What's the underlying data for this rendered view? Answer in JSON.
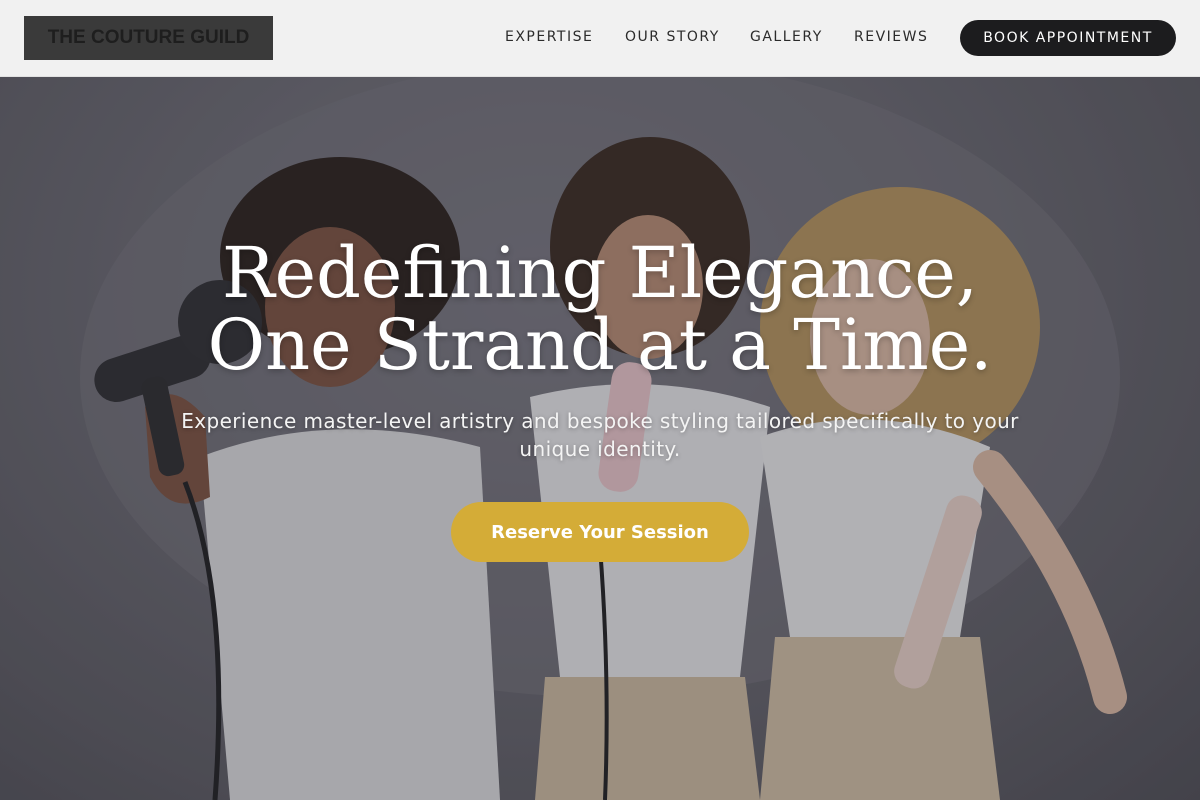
{
  "brand": {
    "name": "THE COUTURE GUILD"
  },
  "nav": {
    "items": [
      {
        "label": "EXPERTISE"
      },
      {
        "label": "OUR STORY"
      },
      {
        "label": "GALLERY"
      },
      {
        "label": "REVIEWS"
      }
    ],
    "book_label": "BOOK APPOINTMENT"
  },
  "hero": {
    "title": "Redefining Elegance, One Strand at a Time.",
    "subtitle": "Experience master-level artistry and bespoke styling tailored specifically to your unique identity.",
    "cta_label": "Reserve Your Session",
    "image": "three-women-with-hair-styling-tools-photo"
  },
  "colors": {
    "header_bg": "#f1f1f1",
    "button_dark": "#1c1c1e",
    "accent_gold": "#d4ac37",
    "overlay": "#5f5e66"
  }
}
